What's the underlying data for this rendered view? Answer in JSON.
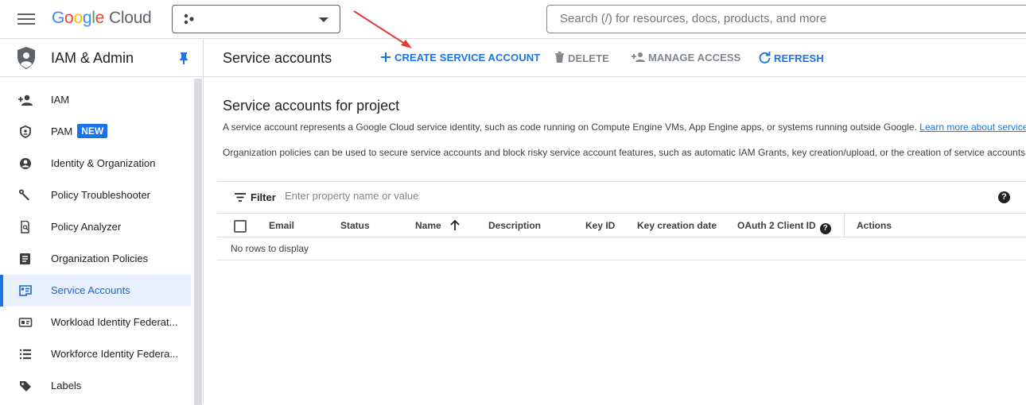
{
  "header": {
    "logo_google": [
      "G",
      "o",
      "o",
      "g",
      "l",
      "e"
    ],
    "logo_cloud": "Cloud",
    "search_placeholder": "Search (/) for resources, docs, products, and more"
  },
  "sidebar": {
    "title": "IAM & Admin",
    "items": [
      {
        "label": "IAM",
        "icon": "person-add-icon"
      },
      {
        "label": "PAM",
        "icon": "shield-icon",
        "badge": "NEW"
      },
      {
        "label": "Identity & Organization",
        "icon": "account-circle-icon"
      },
      {
        "label": "Policy Troubleshooter",
        "icon": "wrench-icon"
      },
      {
        "label": "Policy Analyzer",
        "icon": "document-search-icon"
      },
      {
        "label": "Organization Policies",
        "icon": "policy-document-icon"
      },
      {
        "label": "Service Accounts",
        "icon": "service-account-icon",
        "active": true
      },
      {
        "label": "Workload Identity Federat...",
        "icon": "id-card-icon"
      },
      {
        "label": "Workforce Identity Federa...",
        "icon": "list-icon"
      },
      {
        "label": "Labels",
        "icon": "tag-icon"
      }
    ]
  },
  "toolbar": {
    "page_title": "Service accounts",
    "create_label": "CREATE SERVICE ACCOUNT",
    "delete_label": "DELETE",
    "manage_label": "MANAGE ACCESS",
    "refresh_label": "REFRESH"
  },
  "main": {
    "heading": "Service accounts for project",
    "desc1": "A service account represents a Google Cloud service identity, such as code running on Compute Engine VMs, App Engine apps, or systems running outside Google.",
    "desc1_link": "Learn more about service a",
    "desc2": "Organization policies can be used to secure service accounts and block risky service account features, such as automatic IAM Grants, key creation/upload, or the creation of service accounts"
  },
  "filter": {
    "label": "Filter",
    "placeholder": "Enter property name or value",
    "help": "?"
  },
  "table": {
    "columns": [
      "Email",
      "Status",
      "Name",
      "Description",
      "Key ID",
      "Key creation date",
      "OAuth 2 Client ID",
      "Actions"
    ],
    "sort_column": "Name",
    "sort_direction": "ascending",
    "empty_text": "No rows to display"
  },
  "colors": {
    "accent": "#1a73e8",
    "annotation_arrow": "#e53935"
  }
}
